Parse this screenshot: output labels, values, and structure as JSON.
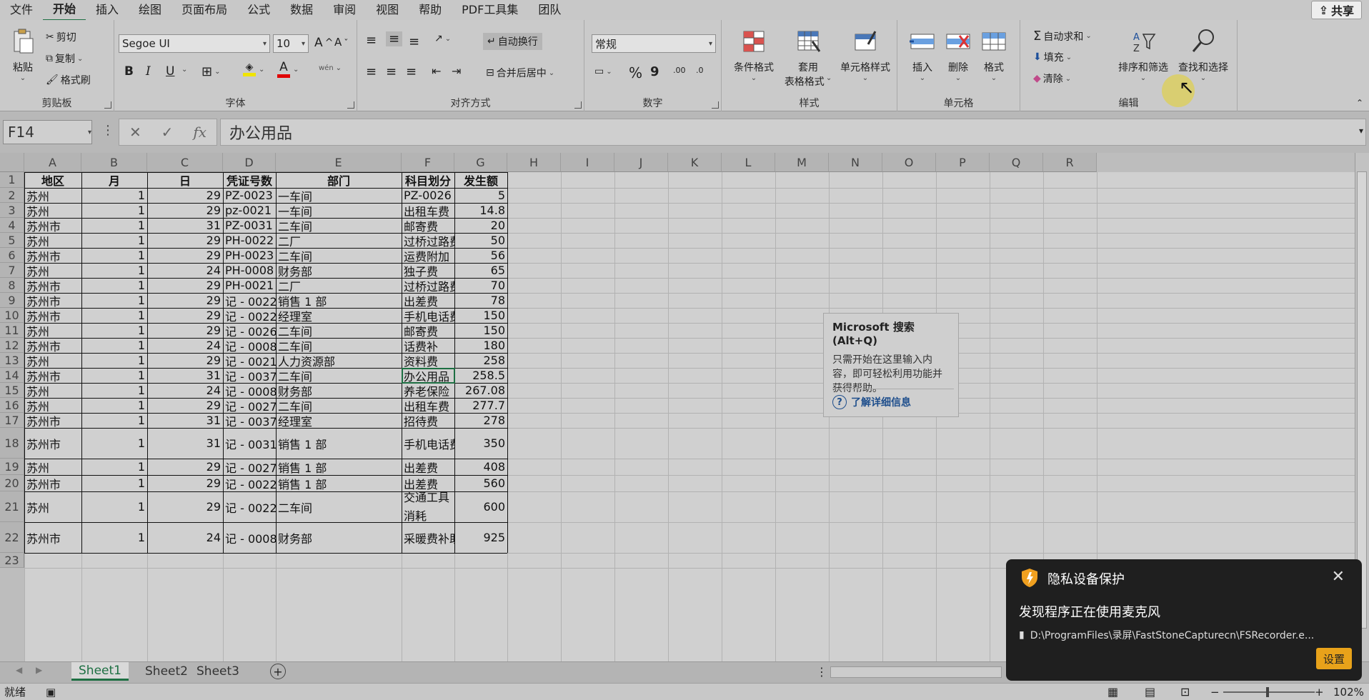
{
  "menu": {
    "items": [
      "文件",
      "开始",
      "插入",
      "绘图",
      "页面布局",
      "公式",
      "数据",
      "审阅",
      "视图",
      "帮助",
      "PDF工具集",
      "团队"
    ],
    "active_index": 1,
    "share": "共享"
  },
  "ribbon": {
    "clipboard": {
      "label": "剪贴板",
      "paste": "粘贴",
      "cut": "剪切",
      "copy": "复制",
      "format_painter": "格式刷"
    },
    "font": {
      "label": "字体",
      "name": "Segoe UI",
      "size": "10",
      "bold": "B",
      "italic": "I",
      "underline": "U",
      "phonetic": "wén"
    },
    "alignment": {
      "label": "对齐方式",
      "wrap": "自动换行",
      "merge": "合并后居中"
    },
    "number": {
      "label": "数字",
      "format": "常规",
      "percent": "%",
      "comma": "9",
      "inc": ".00",
      "dec": ".0"
    },
    "styles": {
      "label": "样式",
      "conditional": "条件格式",
      "table_1": "套用",
      "table_2": "表格格式",
      "cell_styles": "单元格样式"
    },
    "cells": {
      "label": "单元格",
      "insert": "插入",
      "delete": "删除",
      "format": "格式"
    },
    "editing": {
      "label": "编辑",
      "autosum": "自动求和",
      "fill": "填充",
      "clear": "清除",
      "sort": "排序和筛选",
      "find": "查找和选择"
    }
  },
  "formula_bar": {
    "name_box": "F14",
    "formula": "办公用品"
  },
  "grid": {
    "columns": [
      "A",
      "B",
      "C",
      "D",
      "E",
      "F",
      "G",
      "H",
      "I",
      "J",
      "K",
      "L",
      "M",
      "N",
      "O",
      "P",
      "Q",
      "R"
    ],
    "header_row": [
      "地区",
      "月",
      "日",
      "凭证号数",
      "部门",
      "科目划分",
      "发生额"
    ],
    "rows": [
      [
        "苏州",
        "1",
        "29",
        "PZ-0023",
        "一车间",
        "PZ-0026",
        "5"
      ],
      [
        "苏州",
        "1",
        "29",
        "pz-0021",
        "一车间",
        "出租车费",
        "14.8"
      ],
      [
        "苏州市",
        "1",
        "31",
        "PZ-0031",
        "二车间",
        "邮寄费",
        "20"
      ],
      [
        "苏州",
        "1",
        "29",
        "PH-0022",
        "二厂",
        "过桥过路费",
        "50"
      ],
      [
        "苏州市",
        "1",
        "29",
        "PH-0023",
        "二车间",
        "运费附加",
        "56"
      ],
      [
        "苏州",
        "1",
        "24",
        "PH-0008",
        "财务部",
        "独子费",
        "65"
      ],
      [
        "苏州市",
        "1",
        "29",
        "PH-0021",
        "二厂",
        "过桥过路费",
        "70"
      ],
      [
        "苏州市",
        "1",
        "29",
        "记 - 0022",
        "销售 1 部",
        "出差费",
        "78"
      ],
      [
        "苏州市",
        "1",
        "29",
        "记 - 0022",
        "经理室",
        "手机电话费",
        "150"
      ],
      [
        "苏州",
        "1",
        "29",
        "记 - 0026",
        "二车间",
        "邮寄费",
        "150"
      ],
      [
        "苏州市",
        "1",
        "24",
        "记 - 0008",
        "二车间",
        "话费补",
        "180"
      ],
      [
        "苏州",
        "1",
        "29",
        "记 - 0021",
        "人力资源部",
        "资料费",
        "258"
      ],
      [
        "苏州市",
        "1",
        "31",
        "记 - 0037",
        "二车间",
        "办公用品",
        "258.5"
      ],
      [
        "苏州",
        "1",
        "24",
        "记 - 0008",
        "财务部",
        "养老保险",
        "267.08"
      ],
      [
        "苏州",
        "1",
        "29",
        "记 - 0027",
        "二车间",
        "出租车费",
        "277.7"
      ],
      [
        "苏州市",
        "1",
        "31",
        "记 - 0037",
        "经理室",
        "招待费",
        "278"
      ],
      [
        "苏州市",
        "1",
        "31",
        "记 - 0031",
        "销售 1 部",
        "手机电话费",
        "350"
      ],
      [
        "苏州",
        "1",
        "29",
        "记 - 0027",
        "销售 1 部",
        "出差费",
        "408"
      ],
      [
        "苏州市",
        "1",
        "29",
        "记 - 0022",
        "销售 1 部",
        "出差费",
        "560"
      ],
      [
        "苏州",
        "1",
        "29",
        "记 - 0022",
        "二车间",
        "交通工具消耗",
        "600"
      ],
      [
        "苏州市",
        "1",
        "24",
        "记 - 0008",
        "财务部",
        "采暖费补助",
        "925"
      ]
    ]
  },
  "tooltip": {
    "title": "Microsoft 搜索(Alt+Q)",
    "body": "只需开始在这里输入内容，即可轻松利用功能并获得帮助。",
    "link": "了解详细信息"
  },
  "sheets": {
    "tabs": [
      "Sheet1",
      "Sheet2",
      "Sheet3"
    ],
    "active_index": 0
  },
  "status": {
    "ready": "就绪",
    "zoom": "102%"
  },
  "toast": {
    "title": "隐私设备保护",
    "message": "发现程序正在使用麦克风",
    "path": "D:\\ProgramFiles\\录屏\\FastStoneCapturecn\\FSRecorder.e...",
    "button": "设置"
  }
}
